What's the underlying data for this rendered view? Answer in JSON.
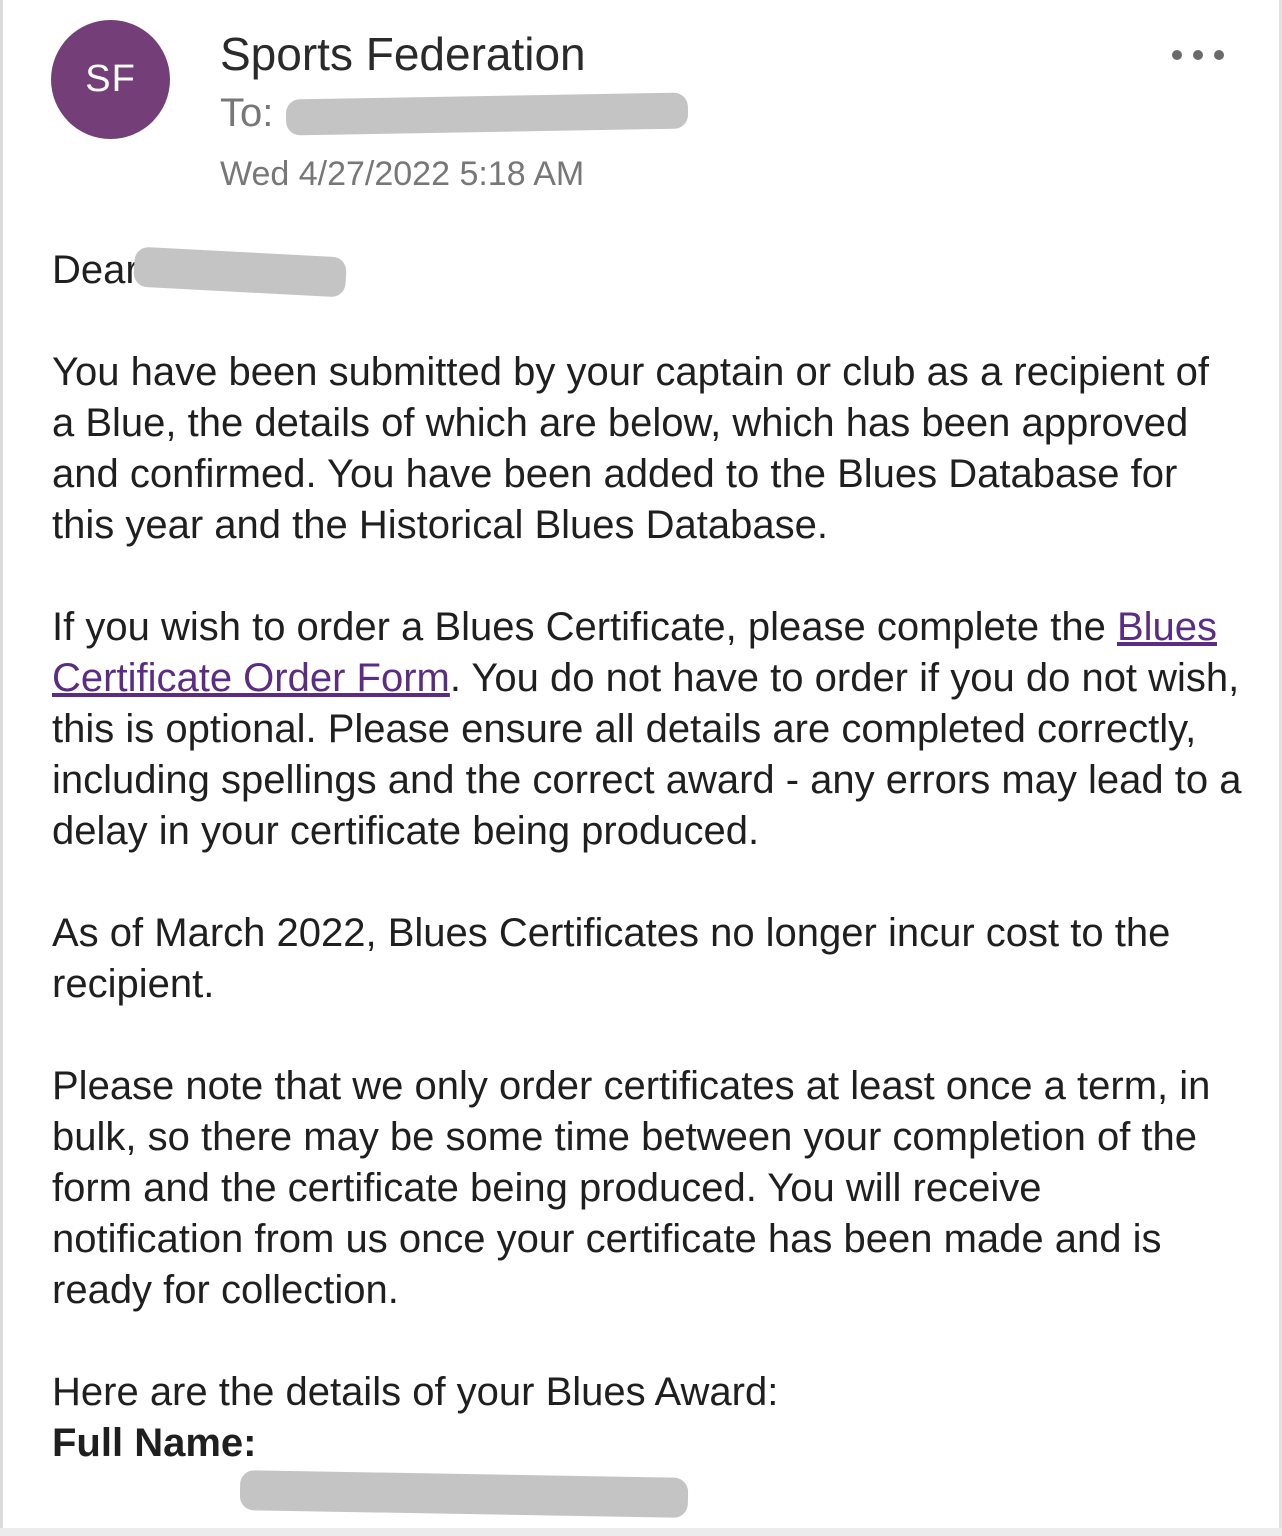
{
  "email": {
    "avatar_initials": "SF",
    "sender": "Sports Federation",
    "to_label": "To:",
    "date": "Wed 4/27/2022 5:18 AM",
    "more_icon": "more-horizontal-icon"
  },
  "body": {
    "greeting": "Dear",
    "p1": "You have been submitted by your captain or club as a recipient of a Blue, the details of which are below, which has been approved and confirmed. You have been added to the Blues Database for this year and the Historical Blues Database.",
    "p2_before": "If you wish to order a Blues Certificate, please complete the ",
    "p2_link": "Blues Certificate Order Form",
    "p2_after": ". You do not have to order if you do not wish, this is optional. Please ensure all details are completed correctly, including spellings and the correct award - any errors may lead to a delay in your certificate being produced.",
    "p3": "As of March 2022, Blues Certificates no longer incur cost to the recipient.",
    "p4": "Please note that we only order certificates at least once a term, in bulk, so there may be some time between your completion of the form and the certificate being produced. You will receive notification from us once your certificate has been made and is ready for collection.",
    "details_intro": "Here are the details of your Blues Award:",
    "full_name_label": "Full Name:"
  },
  "colors": {
    "avatar_bg": "#743f78",
    "link": "#5b2c83",
    "redaction": "#c4c4c4"
  }
}
